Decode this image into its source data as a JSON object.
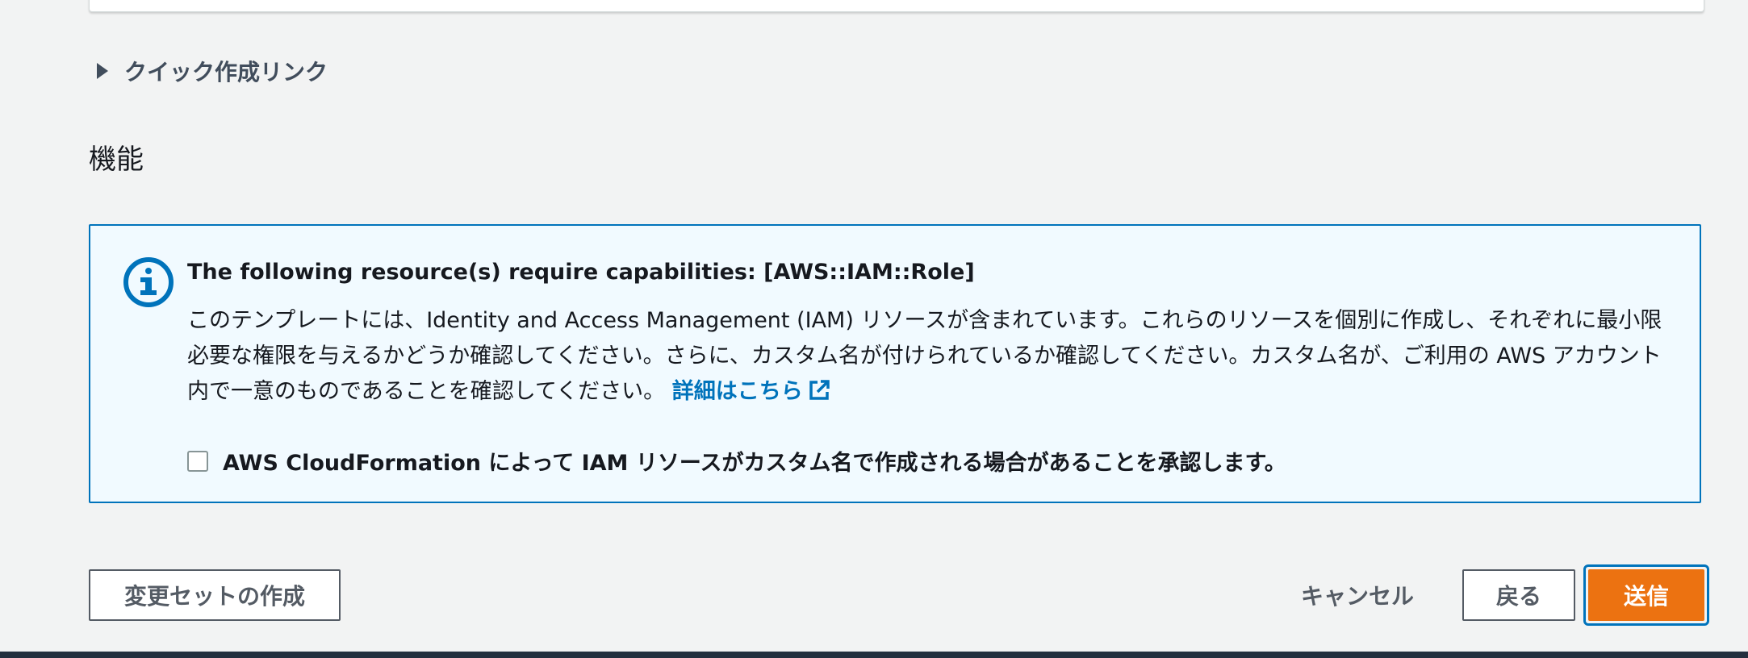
{
  "quick_create": {
    "label": "クイック作成リンク"
  },
  "section": {
    "title": "機能"
  },
  "alert": {
    "title": "The following resource(s) require capabilities: [AWS::IAM::Role]",
    "body": "このテンプレートには、Identity and Access Management (IAM) リソースが含まれています。これらのリソースを個別に作成し、それぞれに最小限必要な権限を与えるかどうか確認してください。さらに、カスタム名が付けられているか確認してください。カスタム名が、ご利用の AWS アカウント内で一意のものであることを確認してください。",
    "link_label": "詳細はこちら",
    "icon": "info-icon",
    "link_icon": "external-link-icon",
    "accent_color": "#0073bb"
  },
  "acknowledgement": {
    "label": "AWS CloudFormation によって IAM リソースがカスタム名で作成される場合があることを承認します。",
    "checked": false
  },
  "actions": {
    "create_changeset_label": "変更セットの作成",
    "cancel_label": "キャンセル",
    "back_label": "戻る",
    "submit_label": "送信",
    "submit_color": "#ec7211"
  }
}
